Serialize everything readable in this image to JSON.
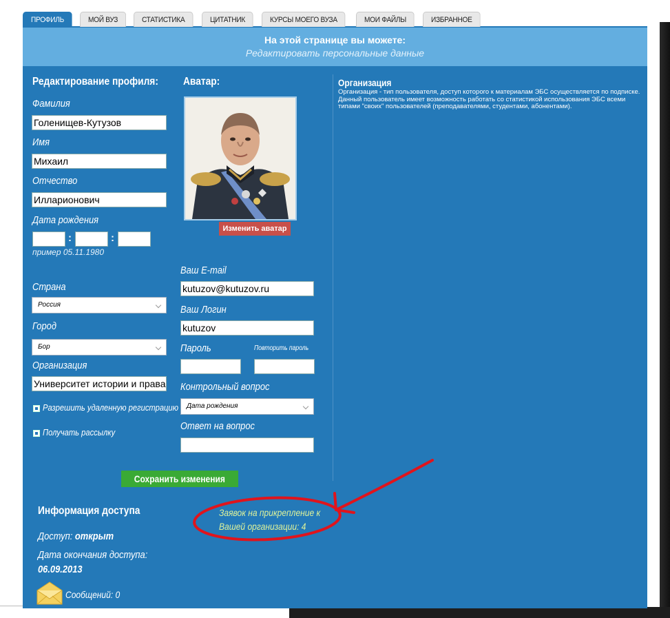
{
  "tabs": [
    "ПРОФИЛЬ",
    "МОЙ ВУЗ",
    "СТАТИСТИКА",
    "ЦИТАТНИК",
    "КУРСЫ МОЕГО ВУЗА",
    "МОИ ФАЙЛЫ",
    "ИЗБРАННОЕ"
  ],
  "banner": {
    "title": "На этой странице вы можете:",
    "subtitle": "Редактировать персональные данные"
  },
  "profile": {
    "heading": "Редактирование профиля:",
    "surname_label": "Фамилия",
    "surname_value": "Голенищев-Кутузов",
    "name_label": "Имя",
    "name_value": "Михаил",
    "patronymic_label": "Отчество",
    "patronymic_value": "Илларионович",
    "birthdate_label": "Дата рождения",
    "birthdate_sep": ":",
    "birthdate_hint": "пример 05.11.1980",
    "country_label": "Страна",
    "country_value": "Россия",
    "city_label": "Город",
    "city_value": "Бор",
    "org_label": "Организация",
    "org_value": "Университет истории и права",
    "remote_reg_label": "Разрешить удаленную регистрацию",
    "newsletter_label": "Получать рассылку",
    "save_button": "Сохранить изменения"
  },
  "avatar": {
    "heading": "Аватар:",
    "change_button": "Изменить аватар"
  },
  "account": {
    "email_label": "Ваш E-mail",
    "email_value": "kutuzov@kutuzov.ru",
    "login_label": "Ваш Логин",
    "login_value": "kutuzov",
    "password_label": "Пароль",
    "repeat_password_label": "Повторить пароль",
    "question_label": "Контрольный вопрос",
    "question_value": "Дата рождения",
    "answer_label": "Ответ на вопрос"
  },
  "organization": {
    "heading": "Организация",
    "description": "Организация - тип пользователя, доступ которого к материалам ЭБС осуществляется по подписке. Данный пользователь имеет возможность работать со статистикой использования ЭБС всеми типами \"своих\" пользователей (преподавателями, студентами, абонентами)."
  },
  "access": {
    "heading": "Информация доступа",
    "status_label": "Доступ:",
    "status_value": "открыт",
    "end_label": "Дата окончания доступа:",
    "end_value": "06.09.2013",
    "messages": "Сообщений: 0",
    "requests_link_line1": "Заявок на прикрепление к",
    "requests_link_line2": "Вашей организации: 4"
  },
  "colors": {
    "panel": "#2479b8",
    "banner": "#63aee0",
    "annotation": "#e0141c",
    "save_button": "#3aaa35",
    "avatar_button": "#c8504a"
  }
}
